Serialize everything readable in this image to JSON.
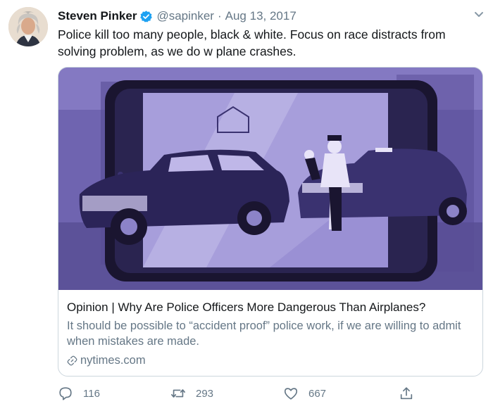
{
  "tweet": {
    "author_name": "Steven Pinker",
    "handle": "@sapinker",
    "separator": "·",
    "date": "Aug 13, 2017",
    "text": "Police kill too many people, black & white. Focus on race distracts from solving problem, as we do w plane crashes."
  },
  "card": {
    "title": "Opinion | Why Are Police Officers More Dangerous Than Airplanes?",
    "description": "It should be possible to “accident proof” police work, if we are willing to admit when mistakes are made.",
    "domain": "nytimes.com",
    "image_icon": "illustration-phone-police-car",
    "image_palette": [
      "#7568b8",
      "#3b3372",
      "#1a1530",
      "#cfc6ef"
    ]
  },
  "actions": {
    "replies": "116",
    "retweets": "293",
    "likes": "667"
  },
  "colors": {
    "text": "#14171a",
    "muted": "#657786",
    "verified": "#1da1f2",
    "border": "#ccd6dd"
  },
  "icons": {
    "verified": "verified-badge-icon",
    "caret": "chevron-down-icon",
    "link": "link-icon",
    "reply": "reply-icon",
    "retweet": "retweet-icon",
    "like": "heart-icon",
    "share": "share-icon"
  }
}
